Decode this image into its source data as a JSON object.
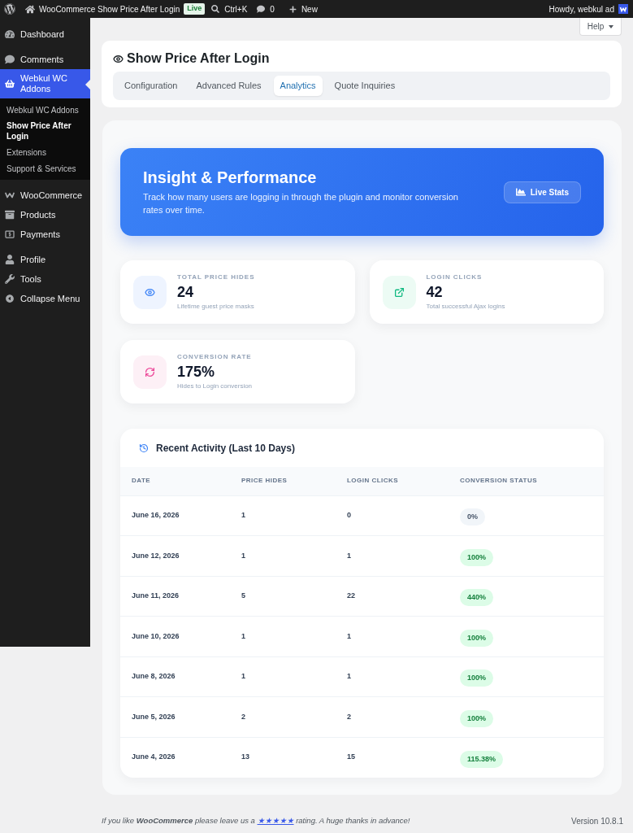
{
  "admin_bar": {
    "site_name": "WooCommerce Show Price After Login",
    "badge": "Live",
    "search_shortcut": "Ctrl+K",
    "comments_count": "0",
    "new_label": "New",
    "greeting": "Howdy, webkul ad"
  },
  "sidebar": {
    "groups": [
      {
        "items": [
          {
            "label": "Dashboard",
            "selected": false
          }
        ]
      },
      {
        "items": [
          {
            "label": "Comments",
            "selected": false
          },
          {
            "label": "Webkul WC Addons",
            "selected": true,
            "children": [
              {
                "label": "Webkul WC Addons",
                "selected": false
              },
              {
                "label": "Show Price After Login",
                "selected": true
              },
              {
                "label": "Extensions",
                "selected": false
              },
              {
                "label": "Support & Services",
                "selected": false
              }
            ]
          }
        ]
      },
      {
        "items": [
          {
            "label": "WooCommerce",
            "selected": false
          },
          {
            "label": "Products",
            "selected": false
          },
          {
            "label": "Payments",
            "selected": false
          }
        ]
      },
      {
        "items": [
          {
            "label": "Profile",
            "selected": false
          },
          {
            "label": "Tools",
            "selected": false
          },
          {
            "label": "Collapse Menu",
            "selected": false
          }
        ]
      }
    ]
  },
  "help_button": {
    "label": "Help"
  },
  "header": {
    "title": "Show Price After Login",
    "tabs": [
      {
        "label": "Configuration",
        "selected": false
      },
      {
        "label": "Advanced Rules",
        "selected": false
      },
      {
        "label": "Analytics",
        "selected": true
      },
      {
        "label": "Quote Inquiries",
        "selected": false
      }
    ]
  },
  "hero": {
    "title": "Insight & Performance",
    "description": "Track how many users are logging in through the plugin and monitor conversion rates over time.",
    "button": "Live Stats"
  },
  "stats": [
    {
      "label": "TOTAL PRICE HIDES",
      "value": "24",
      "description": "Lifetime guest price masks"
    },
    {
      "label": "LOGIN CLICKS",
      "value": "42",
      "description": "Total successful Ajax logins"
    },
    {
      "label": "CONVERSION RATE",
      "value": "175%",
      "description": "Hides to Login conversion"
    }
  ],
  "activity": {
    "title": "Recent Activity (Last 10 Days)",
    "columns": [
      "DATE",
      "PRICE HIDES",
      "LOGIN CLICKS",
      "CONVERSION STATUS"
    ],
    "rows": [
      {
        "date": "June 16, 2026",
        "price_hides": "1",
        "login_clicks": "0",
        "conversion": "0%",
        "kind": "neutral"
      },
      {
        "date": "June 12, 2026",
        "price_hides": "1",
        "login_clicks": "1",
        "conversion": "100%",
        "kind": "success"
      },
      {
        "date": "June 11, 2026",
        "price_hides": "5",
        "login_clicks": "22",
        "conversion": "440%",
        "kind": "success"
      },
      {
        "date": "June 10, 2026",
        "price_hides": "1",
        "login_clicks": "1",
        "conversion": "100%",
        "kind": "success"
      },
      {
        "date": "June 8, 2026",
        "price_hides": "1",
        "login_clicks": "1",
        "conversion": "100%",
        "kind": "success"
      },
      {
        "date": "June 5, 2026",
        "price_hides": "2",
        "login_clicks": "2",
        "conversion": "100%",
        "kind": "success"
      },
      {
        "date": "June 4, 2026",
        "price_hides": "13",
        "login_clicks": "15",
        "conversion": "115.38%",
        "kind": "success"
      }
    ]
  },
  "footer": {
    "before": "If you like **WooCommerce** please leave us a ",
    "link": "★★★★★",
    "after": " rating. A huge thanks in advance!",
    "version": "Version 10.8.1"
  }
}
